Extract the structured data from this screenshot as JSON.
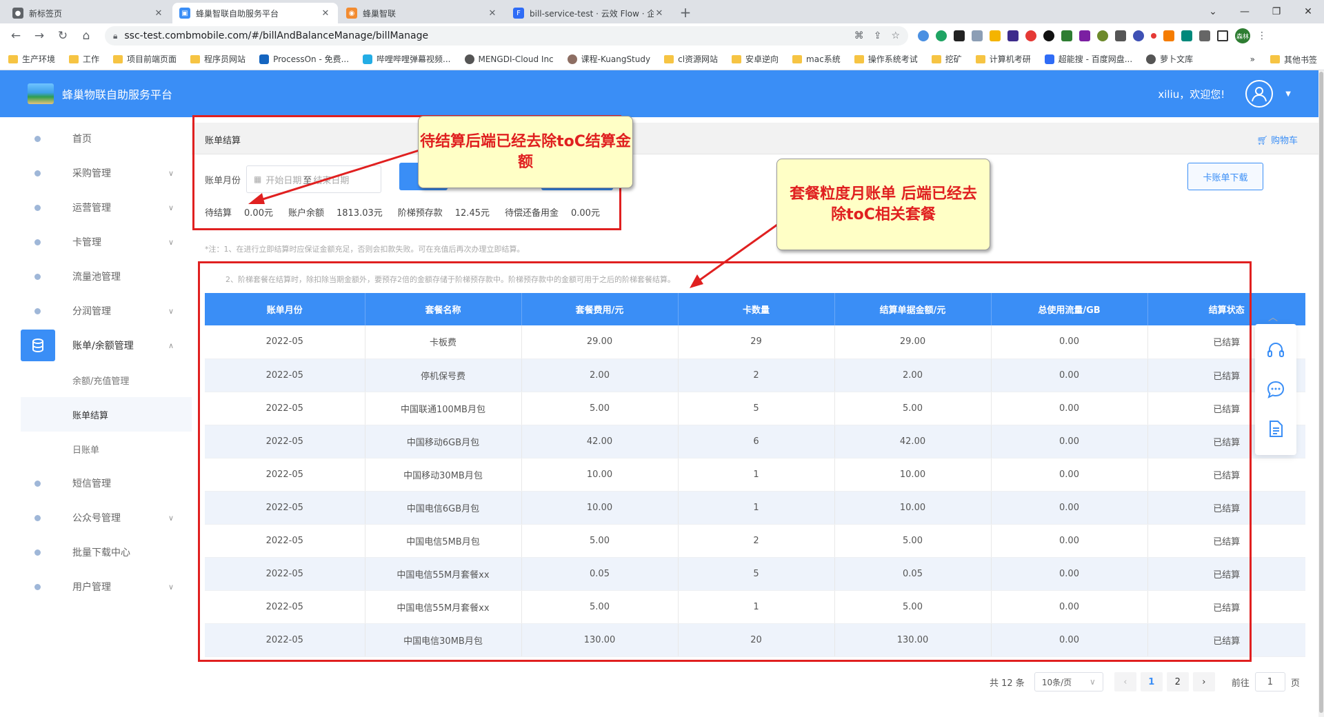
{
  "browser": {
    "tabs": [
      {
        "label": "新标签页",
        "active": false,
        "color": "#5f6368"
      },
      {
        "label": "蜂巢智联自助服务平台",
        "active": true,
        "color": "#3a8ef6"
      },
      {
        "label": "蜂巢智联",
        "active": false,
        "color": "#f28b30"
      },
      {
        "label": "bill-service-test · 云效 Flow · 企",
        "active": false,
        "color": "#2f6cf6"
      }
    ],
    "url": "ssc-test.combmobile.com/#/billAndBalanceManage/billManage",
    "bookmarks": [
      "生产环境",
      "工作",
      "项目前端页面",
      "程序员网站",
      "ProcessOn - 免费...",
      "哔哩哔哩弹幕视频...",
      "MENGDI-Cloud Inc",
      "课程-KuangStudy",
      "cl资源网站",
      "安卓逆向",
      "mac系统",
      "操作系统考试",
      "挖矿",
      "计算机考研",
      "超能搜 - 百度网盘...",
      "萝卜文库"
    ],
    "bookmarks_more": "»",
    "bookmarks_other": "其他书签",
    "profile": "森林"
  },
  "app": {
    "title": "蜂巢物联自助服务平台",
    "welcome": "xiliu，欢迎您!"
  },
  "sidebar": {
    "items": [
      {
        "label": "首页",
        "chevron": false
      },
      {
        "label": "采购管理",
        "chevron": true
      },
      {
        "label": "运营管理",
        "chevron": true
      },
      {
        "label": "卡管理",
        "chevron": true
      },
      {
        "label": "流量池管理",
        "chevron": false
      },
      {
        "label": "分润管理",
        "chevron": true
      },
      {
        "label": "账单/余额管理",
        "chevron": true,
        "active": true
      },
      {
        "label": "短信管理",
        "chevron": false
      },
      {
        "label": "公众号管理",
        "chevron": true
      },
      {
        "label": "批量下载中心",
        "chevron": false
      },
      {
        "label": "用户管理",
        "chevron": true
      }
    ],
    "subitems": [
      "余额/充值管理",
      "账单结算",
      "日账单"
    ]
  },
  "page": {
    "title": "账单结算",
    "cart": "购物车",
    "filter_label": "账单月份",
    "start_placeholder": "开始日期",
    "range_sep": "至",
    "end_placeholder": "结束日期",
    "download_button": "卡账单下载",
    "summary": {
      "pending_label": "待结算",
      "pending_value": "0.00元",
      "balance_label": "账户余额",
      "balance_value": "1813.03元",
      "tier_label": "阶梯预存款",
      "tier_value": "12.45元",
      "reserve_label": "待偿还备用金",
      "reserve_value": "0.00元"
    },
    "note1": "*注：1、在进行立即结算时应保证金额充足，否则会扣款失败。可在充值后再次办理立即结算。",
    "note2": "2、阶梯套餐在结算时，除扣除当期金额外，要预存2倍的金额存储于阶梯预存款中。阶梯预存款中的金额可用于之后的阶梯套餐结算。"
  },
  "table": {
    "headers": [
      "账单月份",
      "套餐名称",
      "套餐费用/元",
      "卡数量",
      "结算单据金额/元",
      "总使用流量/GB",
      "结算状态"
    ],
    "rows": [
      [
        "2022-05",
        "卡板费",
        "29.00",
        "29",
        "29.00",
        "0.00",
        "已结算"
      ],
      [
        "2022-05",
        "停机保号费",
        "2.00",
        "2",
        "2.00",
        "0.00",
        "已结算"
      ],
      [
        "2022-05",
        "中国联通100MB月包",
        "5.00",
        "5",
        "5.00",
        "0.00",
        "已结算"
      ],
      [
        "2022-05",
        "中国移动6GB月包",
        "42.00",
        "6",
        "42.00",
        "0.00",
        "已结算"
      ],
      [
        "2022-05",
        "中国移动30MB月包",
        "10.00",
        "1",
        "10.00",
        "0.00",
        "已结算"
      ],
      [
        "2022-05",
        "中国电信6GB月包",
        "10.00",
        "1",
        "10.00",
        "0.00",
        "已结算"
      ],
      [
        "2022-05",
        "中国电信5MB月包",
        "5.00",
        "2",
        "5.00",
        "0.00",
        "已结算"
      ],
      [
        "2022-05",
        "中国电信55M月套餐xx",
        "0.05",
        "5",
        "0.05",
        "0.00",
        "已结算"
      ],
      [
        "2022-05",
        "中国电信55M月套餐xx",
        "5.00",
        "1",
        "5.00",
        "0.00",
        "已结算"
      ],
      [
        "2022-05",
        "中国电信30MB月包",
        "130.00",
        "20",
        "130.00",
        "0.00",
        "已结算"
      ]
    ]
  },
  "pagination": {
    "total": "共 12 条",
    "page_size": "10条/页",
    "pages": [
      "1",
      "2"
    ],
    "current": "1",
    "goto_label": "前往",
    "goto_value": "1",
    "goto_suffix": "页"
  },
  "annotations": {
    "callout1": "待结算后端已经去除toC结算金额",
    "callout2": "套餐粒度月账单 后端已经去除toC相关套餐"
  },
  "colors": {
    "primary": "#3a8ef6",
    "annotation": "#e02020",
    "callout_bg": "#ffffc6"
  }
}
